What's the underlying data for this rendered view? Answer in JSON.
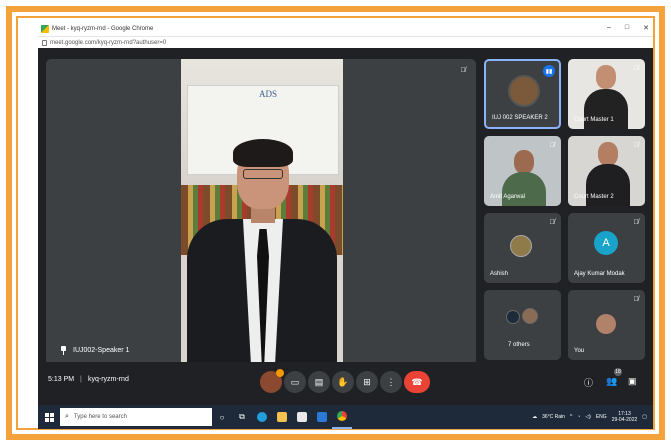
{
  "browser": {
    "window_title": "Meet - kyq-ryzm-rnd - Google Chrome",
    "url": "meet.google.com/kyq-ryzm-rnd?authuser=0",
    "controls": [
      "–",
      "□",
      "✕"
    ]
  },
  "main_tile": {
    "speaker_name": "IUJ002-Speaker 1",
    "board_text": "ADS"
  },
  "participants": [
    {
      "name": "IUJ 002 SPEAKER 2"
    },
    {
      "name": "Court Master 1"
    },
    {
      "name": "Amit Agarwal"
    },
    {
      "name": "Court Master 2"
    },
    {
      "name": "Ashish"
    },
    {
      "name": "Ajay Kumar Modak",
      "initial": "A"
    },
    {
      "name": "7 others"
    },
    {
      "name": "You"
    }
  ],
  "bottom_bar": {
    "time": "5:13 PM",
    "separator": "|",
    "meeting_code": "kyq-ryzm-rnd",
    "people_count": "18"
  },
  "taskbar": {
    "search_placeholder": "Type here to search",
    "weather": "36°C  Rain",
    "lang": "ENG",
    "time": "17:13",
    "date": "29-04-2022"
  },
  "colors": {
    "frame_orange": "#f4a23c",
    "meet_bg": "#202124",
    "tile_bg": "#3c4043",
    "end_call_red": "#ea4335",
    "active_border": "#8ab4f8"
  }
}
